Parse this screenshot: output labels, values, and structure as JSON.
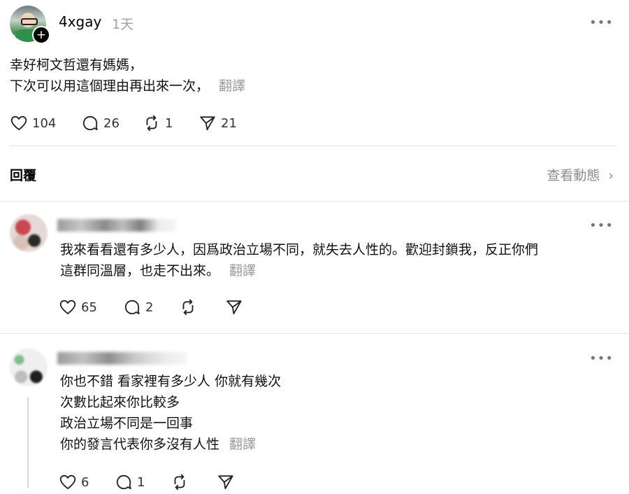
{
  "post": {
    "username": "4xgay",
    "time_ago": "1天",
    "lines": [
      "幸好柯文哲還有媽媽，",
      "下次可以用這個理由再出來一次，"
    ],
    "translate_label": "翻譯",
    "likes": "104",
    "comments": "26",
    "reposts": "1",
    "shares": "21"
  },
  "replies_header": {
    "label": "回覆",
    "activity_link": "查看動態"
  },
  "replies": [
    {
      "lines": [
        "我來看看還有多少人，因爲政治立場不同，就失去人性的。歡迎封鎖我，反正你們",
        "這群同溫層，也走不出來。"
      ],
      "translate_label": "翻譯",
      "likes": "65",
      "comments": "2"
    },
    {
      "lines": [
        "你也不錯 看家裡有多少人 你就有幾次",
        "次數比起來你比較多",
        "政治立場不同是一回事",
        "你的發言代表你多沒有人性"
      ],
      "translate_label": "翻譯",
      "likes": "6",
      "comments": "1"
    }
  ],
  "icons": {
    "more": "more-dots-icon",
    "heart": "heart-icon",
    "comment": "comment-icon",
    "repost": "repost-icon",
    "share": "share-icon",
    "chevron": "chevron-right-icon",
    "follow": "plus-icon"
  }
}
